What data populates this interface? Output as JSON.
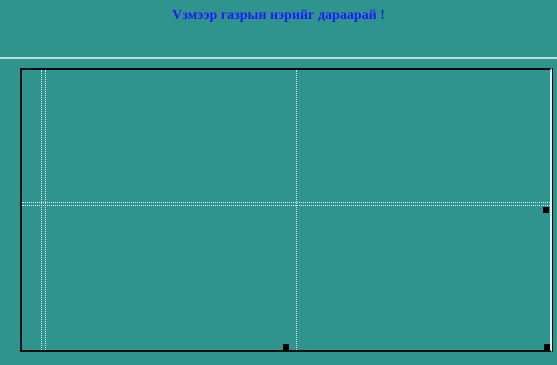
{
  "header": {
    "title": "Vзмээр газрын нэрийг дараарай !"
  },
  "colors": {
    "background": "#2f948e",
    "title_text": "#1a1aff",
    "guides": "#d8ecea",
    "frame": "#0d0d0d"
  },
  "map_grid": {
    "columns": 2,
    "rows": 2
  }
}
